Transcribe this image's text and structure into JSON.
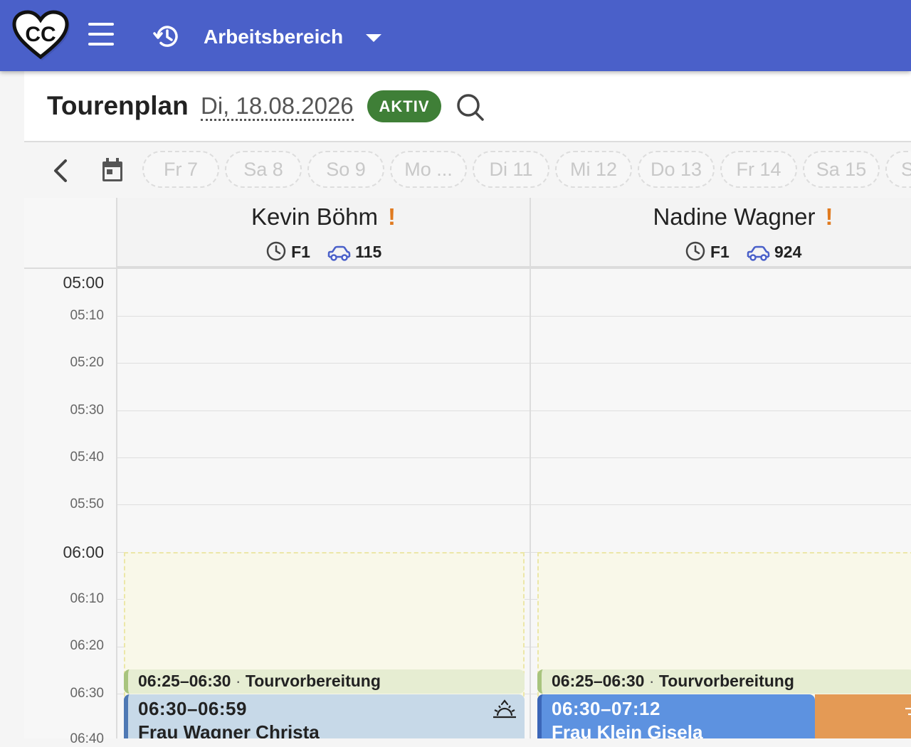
{
  "appbar": {
    "logo_text": "CC",
    "workspace": "Arbeitsbereich"
  },
  "page": {
    "title": "Tourenplan",
    "date": "Di, 18.08.2026",
    "status": "AKTIV"
  },
  "days": [
    "Fr 7",
    "Sa 8",
    "So 9",
    "Mo ...",
    "Di 11",
    "Mi 12",
    "Do 13",
    "Fr 14",
    "Sa 15",
    "S"
  ],
  "employees": [
    {
      "name": "Kevin Böhm",
      "warning": "!",
      "shift": "F1",
      "vehicle": "115",
      "prep": {
        "time": "06:25–06:30",
        "label": "Tourvorbereitung"
      },
      "visit": {
        "time": "06:30–06:59",
        "name": "Frau Wagner Christa"
      }
    },
    {
      "name": "Nadine Wagner",
      "warning": "!",
      "shift": "F1",
      "vehicle": "924",
      "prep": {
        "time": "06:25–06:30",
        "label": "Tourvorbereitung"
      },
      "visit": {
        "time": "06:30–07:12",
        "name": "Frau Klein Gisela"
      }
    }
  ],
  "times": [
    "05:00",
    "05:10",
    "05:20",
    "05:30",
    "05:40",
    "05:50",
    "06:00",
    "06:10",
    "06:20",
    "06:30",
    "06:40"
  ],
  "colors": {
    "appbar": "#4a60c9",
    "status_active": "#3f7f37",
    "warning": "#e07a1f",
    "vehicle_icon": "#4a60c9"
  },
  "icons": [
    "cc-heart-logo-icon",
    "menu-icon",
    "history-icon",
    "chevron-down-icon",
    "search-icon",
    "chevron-left-icon",
    "calendar-icon",
    "clock-icon",
    "car-icon",
    "sunrise-icon"
  ]
}
